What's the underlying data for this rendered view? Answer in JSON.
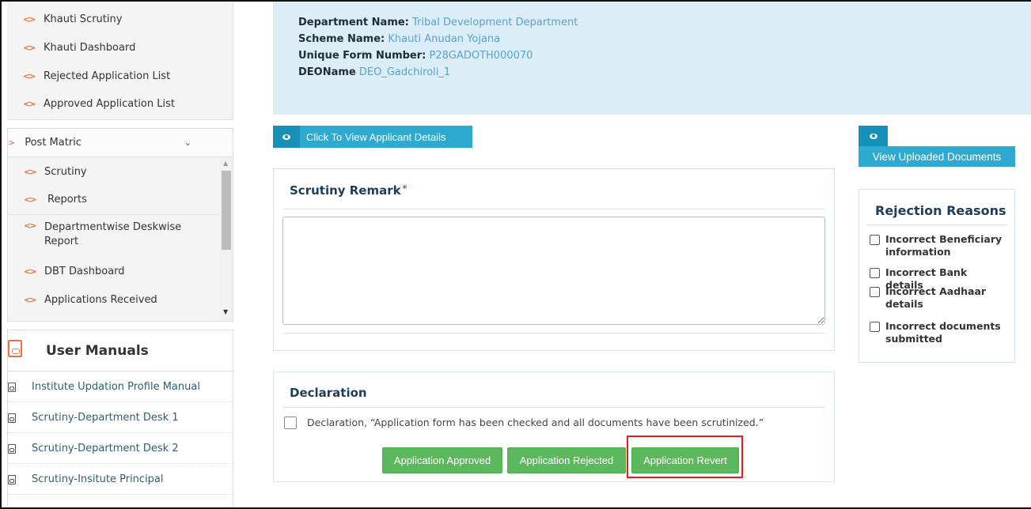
{
  "sidebar": {
    "top_items": [
      {
        "label": "Khauti Scrutiny"
      },
      {
        "label": "Khauti Dashboard"
      },
      {
        "label": "Rejected Application List"
      },
      {
        "label": "Approved Application List"
      }
    ],
    "post_matric": {
      "label": "Post Matric",
      "items": [
        {
          "label": "Scrutiny"
        },
        {
          "label": "Reports"
        },
        {
          "label": "Departmentwise Deskwise Report"
        },
        {
          "label": "DBT Dashboard"
        },
        {
          "label": "Applications Received"
        }
      ]
    },
    "user_manuals": {
      "title": "User Manuals",
      "items": [
        {
          "label": "Institute Updation Profile Manual"
        },
        {
          "label": "Scrutiny-Department Desk 1"
        },
        {
          "label": "Scrutiny-Department Desk 2"
        },
        {
          "label": "Scrutiny-Insitute Principal"
        }
      ]
    }
  },
  "info": {
    "department_label": "Department Name:",
    "department_value": "Tribal Development Department",
    "scheme_label": "Scheme Name:",
    "scheme_value": "Khauti Anudan Yojana",
    "form_label": "Unique Form Number:",
    "form_value": "P28GADOTH000070",
    "deo_label": "DEOName",
    "deo_value": "DEO_Gadchiroli_1"
  },
  "view_applicant_label": "Click To View Applicant Details",
  "view_documents_label": "View Uploaded Documents",
  "remark": {
    "title": "Scrutiny Remark",
    "required_mark": "*",
    "value": ""
  },
  "declaration": {
    "title": "Declaration",
    "text": "Declaration, “Application form has been checked and all documents have been scrutinized.”",
    "checked": false
  },
  "actions": {
    "approve_label": "Application Approved",
    "reject_label": "Application Rejected",
    "revert_label": "Application Revert"
  },
  "rejection": {
    "title": "Rejection Reasons",
    "reasons": [
      {
        "label": "Incorrect Beneficiary information",
        "checked": false
      },
      {
        "label": "Incorrect Bank details",
        "checked": false
      },
      {
        "label": "Incorrect Aadhaar details",
        "checked": false
      },
      {
        "label": "Incorrect documents submitted",
        "checked": false
      }
    ]
  },
  "colors": {
    "accent_blue": "#2eaad1",
    "info_bg": "#dbeef7",
    "green_button": "#5cb85c",
    "highlight_red": "#e0201c",
    "sidebar_icon_orange": "#e8743b"
  },
  "icons": {
    "sidebar_item": "diamond-arrows-icon",
    "view": "eye-icon",
    "manual": "pdf-icon",
    "dropdown": "chevron-down-icon"
  }
}
